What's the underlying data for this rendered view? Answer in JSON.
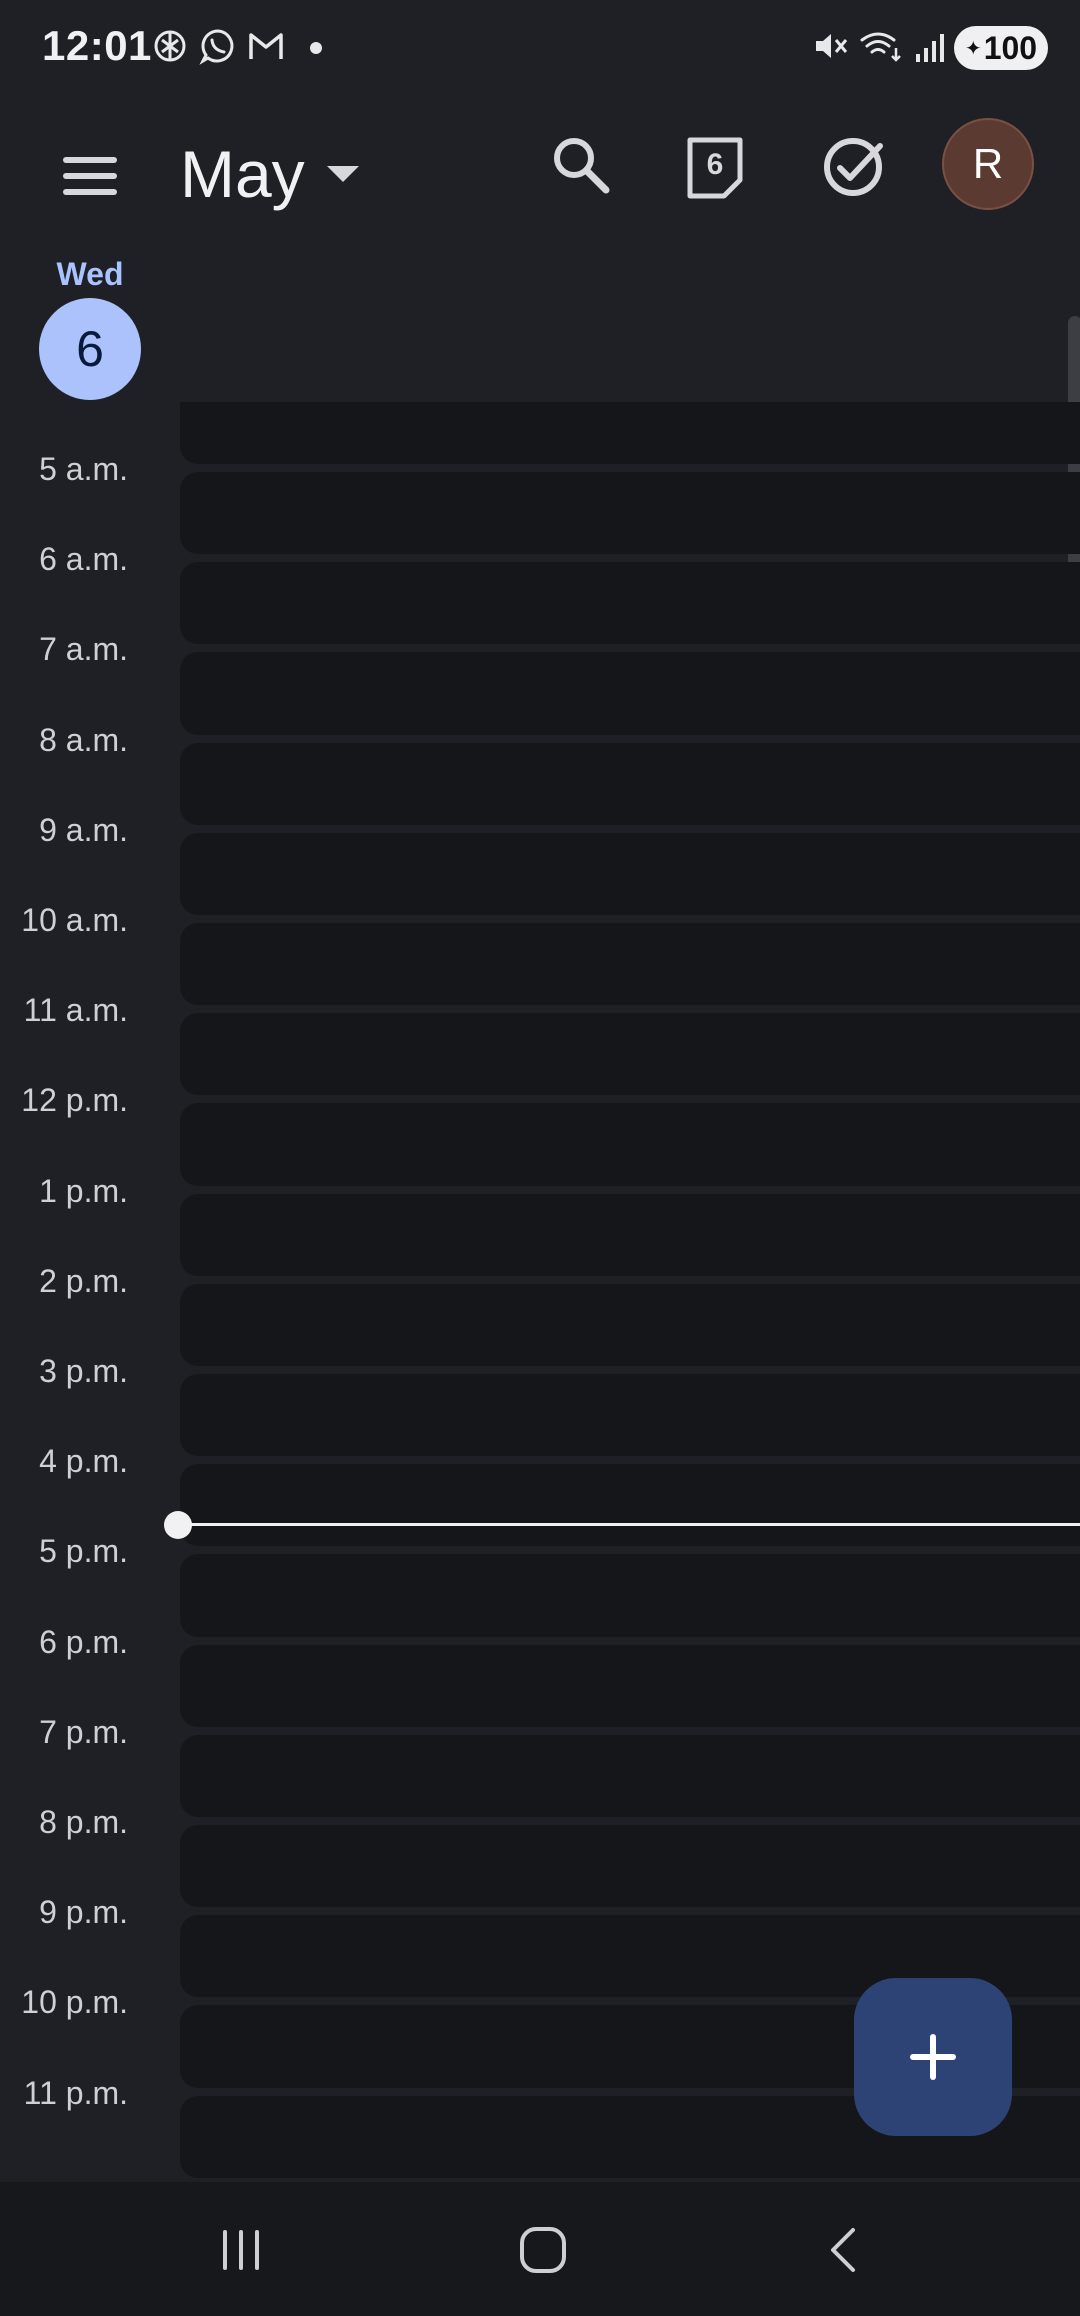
{
  "status_bar": {
    "time": "12:01",
    "battery": "100",
    "notification_icons": [
      "chatgpt-icon",
      "whatsapp-icon",
      "gmail-icon",
      "more-dot-icon"
    ],
    "system_icons": [
      "mute-icon",
      "wifi-icon",
      "signal-icon",
      "battery-icon"
    ]
  },
  "app_bar": {
    "month": "May",
    "today_date": "6",
    "avatar_initial": "R"
  },
  "day": {
    "name": "Wed",
    "date": "6"
  },
  "hours": [
    "5 a.m.",
    "6 a.m.",
    "7 a.m.",
    "8 a.m.",
    "9 a.m.",
    "10 a.m.",
    "11 a.m.",
    "12 p.m.",
    "1 p.m.",
    "2 p.m.",
    "3 p.m.",
    "4 p.m.",
    "5 p.m.",
    "6 p.m.",
    "7 p.m.",
    "8 p.m.",
    "9 p.m.",
    "10 p.m.",
    "11 p.m."
  ],
  "colors": {
    "background": "#1f2025",
    "slot": "#15161a",
    "accent": "#abc2fd",
    "fab": "#2e4375",
    "avatar": "#5a3a31"
  }
}
